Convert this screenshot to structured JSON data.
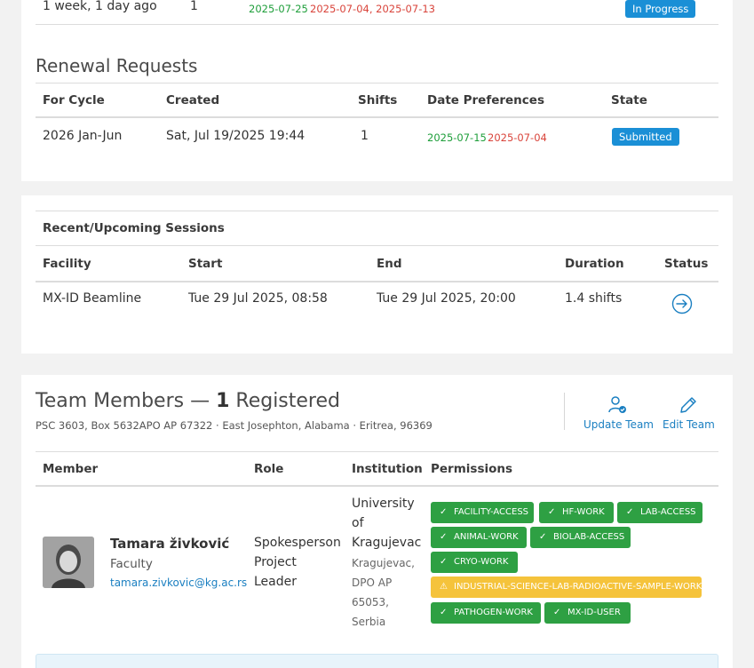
{
  "top_row": {
    "duration": "1 week, 1 day ago",
    "shifts": "1",
    "date_green": "2025-07-25",
    "date_red": "2025-07-04, 2025-07-13",
    "state": "In Progress"
  },
  "renewal": {
    "title": "Renewal Requests",
    "headers": [
      "For Cycle",
      "Created",
      "Shifts",
      "Date Preferences",
      "State"
    ],
    "row": {
      "cycle": "2026 Jan-Jun",
      "created": "Sat, Jul 19/2025 19:44",
      "shifts": "1",
      "date_green": "2025-07-15",
      "date_red": "2025-07-04",
      "state": "Submitted"
    }
  },
  "sessions": {
    "title": "Recent/Upcoming Sessions",
    "headers": [
      "Facility",
      "Start",
      "End",
      "Duration",
      "Status"
    ],
    "row": {
      "facility": "MX-ID Beamline",
      "start": "Tue 29 Jul 2025, 08:58",
      "end": "Tue 29 Jul 2025, 20:00",
      "duration": "1.4 shifts",
      "status_icon": "arrow-circle-right-icon"
    }
  },
  "team": {
    "title_prefix": "Team Members — ",
    "count": "1",
    "title_suffix": " Registered",
    "address": "PSC 3603, Box 5632APO AP 67322 · East Josephton, Alabama · Eritrea, 96369",
    "update_label": "Update Team",
    "edit_label": "Edit Team",
    "headers": [
      "Member",
      "Role",
      "Institution",
      "Permissions"
    ],
    "member": {
      "name": "Tamara živković",
      "type": "Faculty",
      "email": "tamara.zivkovic@kg.ac.rs",
      "role_lines": [
        "Spokesperson",
        "Project",
        "Leader"
      ],
      "institution_lines": [
        "University",
        "of",
        "Kragujevac"
      ],
      "address_lines": [
        "Kragujevac,",
        "DPO AP",
        "65053,",
        "Serbia"
      ]
    },
    "permissions": [
      {
        "label": "FACILITY-ACCESS",
        "kind": "ok"
      },
      {
        "label": "HF-WORK",
        "kind": "ok"
      },
      {
        "label": "LAB-ACCESS",
        "kind": "ok"
      },
      {
        "label": "ANIMAL-WORK",
        "kind": "ok"
      },
      {
        "label": "BIOLAB-ACCESS",
        "kind": "ok"
      },
      {
        "label": "CRYO-WORK",
        "kind": "ok"
      },
      {
        "label": "INDUSTRIAL-SCIENCE-LAB-RADIOACTIVE-SAMPLE-WORK",
        "kind": "warn"
      },
      {
        "label": "PATHOGEN-WORK",
        "kind": "ok"
      },
      {
        "label": "MX-ID-USER",
        "kind": "ok"
      }
    ]
  },
  "colors": {
    "accent": "#1a8fd6",
    "ok": "#2ea043",
    "warn": "#f5c33b",
    "green_text": "#1e9e3a",
    "red_text": "#d9443b"
  }
}
